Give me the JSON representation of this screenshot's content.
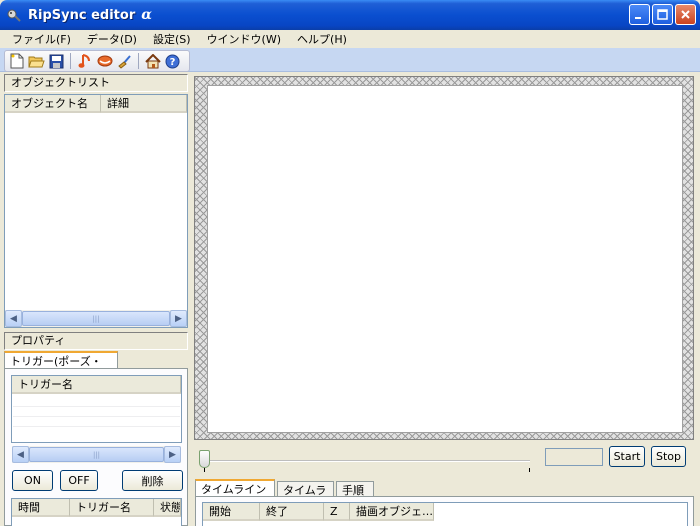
{
  "window": {
    "title": "RipSync editor",
    "title_suffix": "α"
  },
  "menu": [
    {
      "label": "ファイル(F)"
    },
    {
      "label": "データ(D)"
    },
    {
      "label": "設定(S)"
    },
    {
      "label": "ウインドウ(W)"
    },
    {
      "label": "ヘルプ(H)"
    }
  ],
  "toolbar": {
    "icons": [
      "new-file-icon",
      "open-folder-icon",
      "save-disk-icon",
      "music-note-icon",
      "mouth-icon",
      "broom-icon",
      "home-icon",
      "help-icon"
    ]
  },
  "object_list": {
    "title": "オブジェクトリスト",
    "columns": [
      "オブジェクト名",
      "詳細"
    ]
  },
  "properties": {
    "title": "プロパティ",
    "tab_label": "トリガー(ポーズ・表情)",
    "trigger_column": "トリガー名",
    "buttons": {
      "on": "ON",
      "off": "OFF",
      "delete": "削除"
    },
    "trigger_table_columns": [
      "時間",
      "トリガー名",
      "状態"
    ]
  },
  "playback": {
    "start_label": "Start",
    "stop_label": "Stop"
  },
  "timeline": {
    "tabs": [
      "タイムライン情報",
      "タイムライン",
      "手順"
    ],
    "columns": [
      "開始",
      "終了",
      "Z",
      "描画オブジェ…"
    ]
  },
  "colors": {
    "titlebar": "#0a4fd0",
    "toolbar_strip": "#c6d7f2",
    "window_bg": "#ece9d8",
    "tab_accent": "#f0a832"
  }
}
